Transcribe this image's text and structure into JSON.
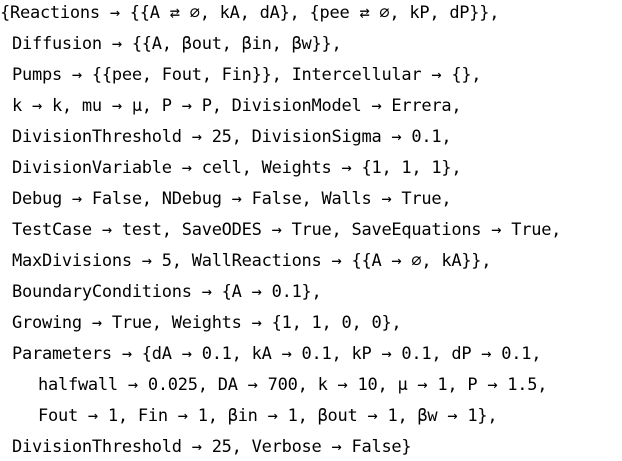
{
  "output": {
    "lines": [
      "{Reactions → {{A ⇄ ∅, kA, dA}, {pee ⇄ ∅, kP, dP}},",
      "Diffusion → {{A, βout, βin, βw}},",
      "Pumps → {{pee, Fout, Fin}}, Intercellular → {},",
      "k → k, mu → μ, P → P, DivisionModel → Errera,",
      "DivisionThreshold → 25, DivisionSigma → 0.1,",
      "DivisionVariable → cell, Weights → {1, 1, 1},",
      "Debug → False, NDebug → False, Walls → True,",
      "TestCase → test, SaveODES → True, SaveEquations → True,",
      "MaxDivisions → 5, WallReactions → {{A → ∅, kA}},",
      "BoundaryConditions → {A → 0.1},",
      "Growing → True, Weights → {1, 1, 0, 0},",
      "Parameters → {dA → 0.1, kA → 0.1, kP → 0.1, dP → 0.1,",
      "halfwall → 0.025, DA → 700, k → 10, μ → 1, P → 1.5,",
      "Fout → 1, Fin → 1, βin → 1, βout → 1, βw → 1},",
      "DivisionThreshold → 25, Verbose → False}"
    ]
  }
}
